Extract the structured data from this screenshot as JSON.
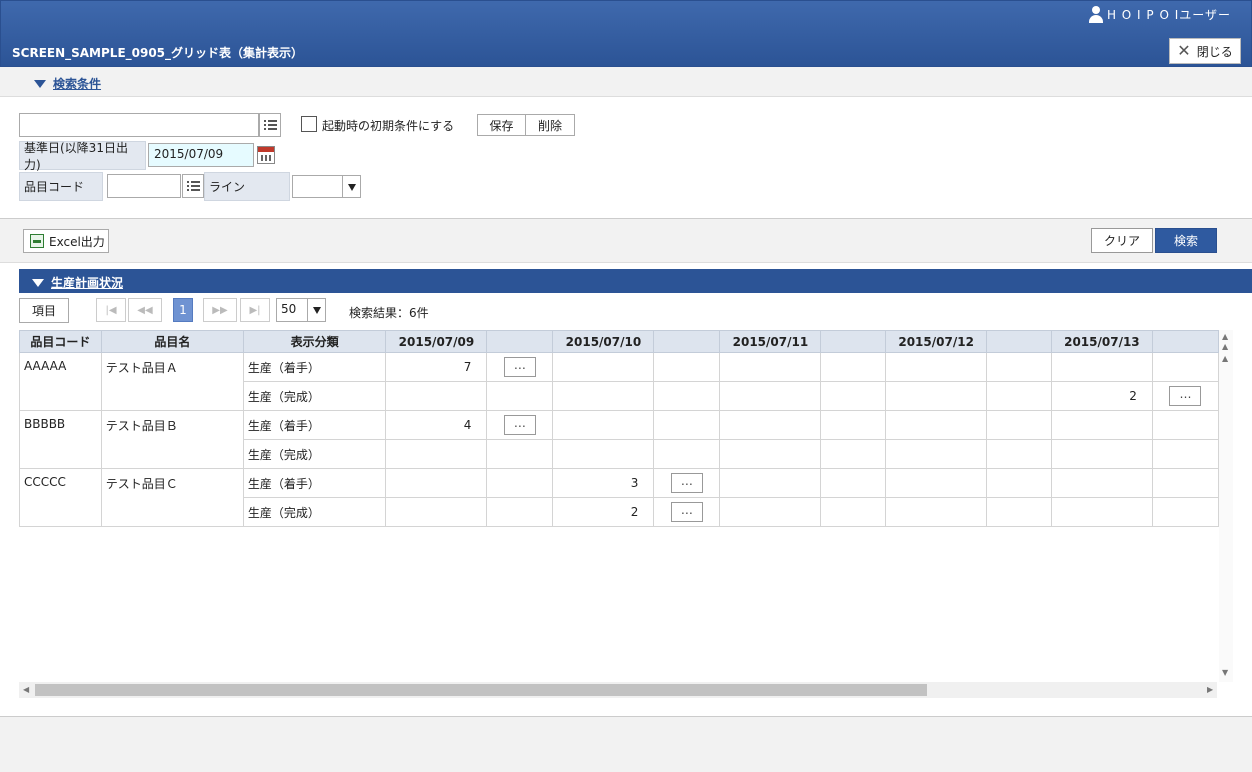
{
  "header": {
    "user_name": "H O I P O Iユーザー",
    "screen_title": "SCREEN_SAMPLE_0905_グリッド表（集計表示）",
    "close_label": "閉じる"
  },
  "conditions": {
    "section_label": "検索条件",
    "preset_value": "",
    "startup_label": "起動時の初期条件にする",
    "save_label": "保存",
    "delete_label": "削除",
    "base_date_label": "基準日(以降31日出力)",
    "base_date_value": "2015/07/09",
    "item_code_label": "品目コード",
    "item_code_value": "",
    "line_label": "ライン",
    "line_value": ""
  },
  "actions": {
    "excel_label": "Excel出力",
    "clear_label": "クリア",
    "search_label": "検索"
  },
  "result": {
    "section_label": "生産計画状況",
    "columns_button": "項目",
    "page": "1",
    "page_size": "50",
    "result_count": "検索結果：6件"
  },
  "grid": {
    "headers": {
      "code": "品目コード",
      "name": "品目名",
      "category": "表示分類",
      "dates": [
        "2015/07/09",
        "2015/07/10",
        "2015/07/11",
        "2015/07/12",
        "2015/07/13"
      ]
    },
    "dot_label": "…",
    "items": [
      {
        "code": "AAAAA",
        "name": "テスト品目Ａ",
        "rows": [
          {
            "category": "生産（着手）",
            "values": [
              "7",
              "",
              "",
              "",
              ""
            ]
          },
          {
            "category": "生産（完成）",
            "values": [
              "",
              "",
              "",
              "",
              "2"
            ]
          }
        ]
      },
      {
        "code": "BBBBB",
        "name": "テスト品目Ｂ",
        "rows": [
          {
            "category": "生産（着手）",
            "values": [
              "4",
              "",
              "",
              "",
              ""
            ]
          },
          {
            "category": "生産（完成）",
            "values": [
              "",
              "",
              "",
              "",
              ""
            ]
          }
        ]
      },
      {
        "code": "CCCCC",
        "name": "テスト品目Ｃ",
        "rows": [
          {
            "category": "生産（着手）",
            "values": [
              "",
              "3",
              "",
              "",
              ""
            ]
          },
          {
            "category": "生産（完成）",
            "values": [
              "",
              "2",
              "",
              "",
              ""
            ]
          }
        ]
      }
    ]
  }
}
